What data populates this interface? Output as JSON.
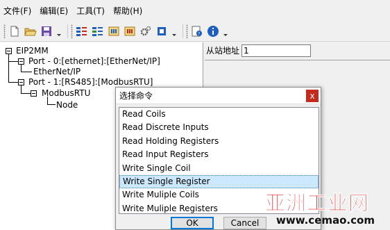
{
  "menubar": {
    "items": [
      "文件(F)",
      "编辑(E)",
      "工具(T)",
      "帮助(H)"
    ]
  },
  "toolbar": {
    "buttons": [
      "new-file-icon",
      "open-folder-icon",
      "save-icon",
      "add-node-icon",
      "remove-node-icon",
      "read-icon",
      "write-icon",
      "settings-icon",
      "chip-icon",
      "help-doc-icon",
      "info-icon"
    ],
    "colors": {
      "blue": "#1f5fbf",
      "green": "#2e8b2e",
      "orange": "#d88a1a",
      "red": "#c42b1c"
    }
  },
  "tree": {
    "root": "EIP2MM",
    "port0": "Port - 0:[ethernet]:[EtherNet/IP]",
    "port0_child": "EtherNet/IP",
    "port1": "Port - 1:[RS485]:[ModbusRTU]",
    "port1_child": "ModbusRTU",
    "node": "Node"
  },
  "right_panel": {
    "addr_label": "从站地址",
    "addr_value": "1"
  },
  "dialog": {
    "title": "选择命令",
    "close_glyph": "x",
    "commands": [
      "Read Coils",
      "Read Discrete Inputs",
      "Read Holding Registers",
      "Read Input Registers",
      "Write Single Coil",
      "Write Single Register",
      "Write Muliple Coils",
      "Write Muliple Registers"
    ],
    "selected_index": 5,
    "ok_label": "OK",
    "cancel_label": "Cancel"
  },
  "watermark": {
    "cn": "亚洲工业网",
    "url": "www.cemao.com",
    "color": "#d60d0d"
  }
}
